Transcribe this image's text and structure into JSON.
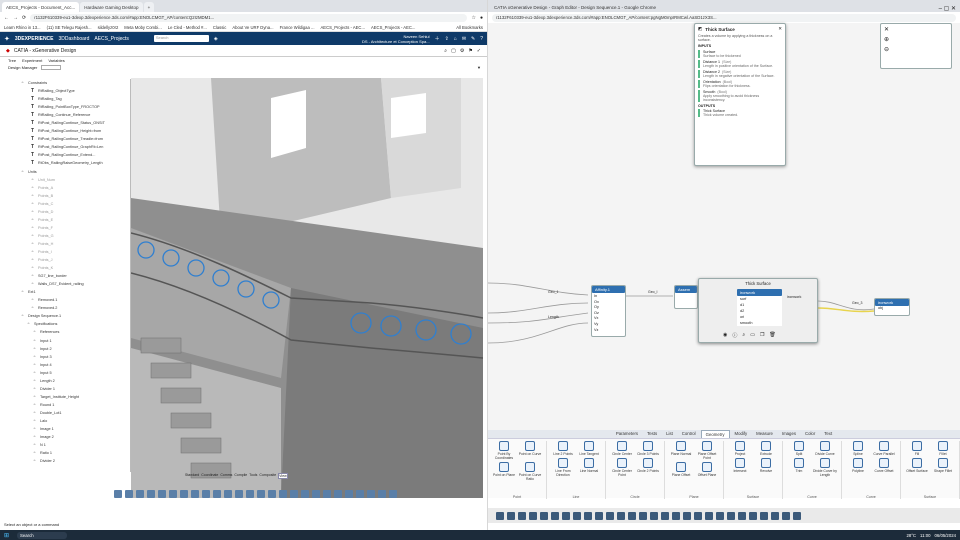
{
  "left_window": {
    "tabs": [
      "AECS_Projects - Document_Acc...",
      "Hardware Gaming Desktop"
    ],
    "url": "r1132F610339-eu1-3dexp.3dexperience.3ds.com/#app:ENOLCMGT_AP/content:Q2IzMDM1...",
    "bookmarks": [
      "Learn Rhino in 13...",
      "(11) SE Telegu Rajesh...",
      "sildellyz0r2",
      "Meta Moby Combi...",
      "Le Cled - Method #...",
      "Classic",
      "About Ve URF Dyna...",
      "France Wildigaa ...",
      "AECS_Projects - AEC...",
      "AECS_Projects - AEC...",
      "All Bookmarks"
    ],
    "ds_bar": {
      "brand": "3DEXPERIENCE",
      "app": "3DDashboard",
      "path": "AECS_Projects",
      "search_placeholder": "Search",
      "user": "Naveen Sehlul",
      "doc": "DS - Architecture et Conception Spa..."
    },
    "app_title": "CATIA - xGenerative Design",
    "tree_tabs": [
      "Tree",
      "Experiment",
      "Variables"
    ],
    "design_manager_label": "Design Manager",
    "tree_rows": [
      "Constraints",
      "RtRailing_ObjectType",
      "RtRailing_Tag",
      "RtRailing_PointBoxType_FROCTOP",
      "RtRailing_Continue_Reference",
      "RtPost_RailingContinue_Status_ONSIT",
      "RtPost_RailingContinue_Height=from",
      "RtPost_RailingContinue_Treadle=from",
      "RtPost_RailingContinue_GraphRt=Len",
      "RtPost_RailingContinue_Extend...",
      "RtObs_RailingRaiseGeometry_Length",
      "Units",
      "Unit_Num",
      "Points_A",
      "Points_B",
      "Points_C",
      "Points_D",
      "Points_E",
      "Points_F",
      "Points_G",
      "Points_H",
      "Points_I",
      "Points_J",
      "Points_K",
      "SG7_line_border",
      "Walls_DS7_Evident_railing",
      "Ext1",
      "Removed.1",
      "Removed.2",
      "Design Sequence.1",
      "Specifications",
      "References",
      "Input 1",
      "Input 2",
      "Input 3",
      "Input 4",
      "Input 5",
      "Length 2",
      "Divider 1",
      "Target_Institute_Height",
      "Round 1",
      "Double_Lot1",
      "Lalo",
      "Image 1",
      "Image 2",
      "N 1",
      "Ratio 1",
      "Divider 2"
    ],
    "bottom_tabs": [
      "Standard",
      "Coordinate",
      "Comms",
      "Compile",
      "Tools",
      "Composite",
      "View"
    ],
    "status": "Select an object or a command"
  },
  "right_window": {
    "tab": "CATIA xGenerative Design - Graph Editor - Design Sequence.1 - Google Chrome",
    "url": "r1132F610339-eu1-3dexp.3dexperience.3ds.com/#app:ENOLCMGT_AP/content:pgNgM0mpIRMCwl.AaSD1zX3S...",
    "panel": {
      "title": "Thick Surface",
      "desc": "Creates a volume by applying a thickness on a surface.",
      "inputs_label": "INPUTS",
      "inputs": [
        {
          "name": "Surface",
          "desc": "Surface to be thickened"
        },
        {
          "name": "Distance 1",
          "type": "(Size)",
          "desc": "Length in positive orientation of the Surface."
        },
        {
          "name": "Distance 2",
          "type": "(Size)",
          "desc": "Length in negative orientation of the Surface."
        },
        {
          "name": "Orientation",
          "type": "(Bool)",
          "desc": "Flips orientation for thickness."
        },
        {
          "name": "Smooth",
          "type": "(Bool)",
          "desc": "Apply smoothing to avoid thickness inconsistency."
        }
      ],
      "outputs_label": "OUTPUTS",
      "output": {
        "name": "Thick Surface",
        "desc": "Thick volume created."
      }
    },
    "nodes": {
      "affinity": {
        "title": "Affinity.1",
        "ports": [
          "In",
          "Ox",
          "Oy",
          "Oz",
          "Vx",
          "Vy",
          "Vz"
        ]
      },
      "assembly": {
        "title": "Assem"
      },
      "thick_popup": {
        "title": "Thick Surface",
        "header": "ironwork",
        "ports": [
          "surf",
          "d1",
          "d2",
          "ori",
          "smooth"
        ],
        "out": "ironwork"
      },
      "ironwork": {
        "title": "ironwork",
        "port": "obj"
      }
    },
    "edge_labels": [
      "Geo_1",
      "Length",
      "Geo_I",
      "Geo_3"
    ],
    "ribbon_tabs": [
      "Parameters",
      "Tests",
      "List",
      "Control",
      "Geometry",
      "Modify",
      "Measure",
      "Images",
      "Color",
      "Text"
    ],
    "tool_groups": [
      {
        "label": "Point",
        "tools": [
          "Point By Coordinates",
          "Point on Curve",
          "Point on Plane",
          "Point on Curve Ratio"
        ]
      },
      {
        "label": "Line",
        "tools": [
          "Line 2 Points",
          "Line Tangent",
          "Line From Direction",
          "Line Normal"
        ]
      },
      {
        "label": "Circle",
        "tools": [
          "Circle Center",
          "Circle 3 Points",
          "Circle Center Point",
          "Circle 2 Points"
        ]
      },
      {
        "label": "Plane",
        "tools": [
          "Plane Normal",
          "Plane Offset Point",
          "Plane Offset",
          "Offset Plane"
        ]
      },
      {
        "label": "Surface",
        "tools": [
          "Project",
          "Extrude",
          "Intersect",
          "Revolve"
        ]
      },
      {
        "label": "Curve",
        "tools": [
          "Split",
          "Divide Curve",
          "Trim",
          "Divide Curve by Length"
        ]
      },
      {
        "label": "Curve",
        "tools": [
          "Spline",
          "Curve Parallel",
          "Polyline",
          "Curve Offset"
        ]
      },
      {
        "label": "Surface",
        "tools": [
          "Fill",
          "Fillet",
          "Offset Surface",
          "Shape Fillet"
        ]
      }
    ]
  },
  "taskbar": {
    "search": "Search",
    "time": "11:00",
    "date": "06/05/2024",
    "weather": "28°C"
  }
}
